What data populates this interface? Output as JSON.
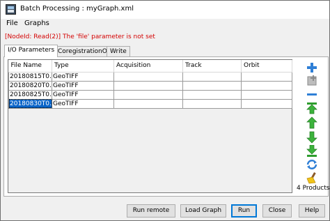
{
  "window": {
    "title": "Batch Processing : myGraph.xml"
  },
  "menu": {
    "items": [
      "File",
      "Graphs"
    ]
  },
  "status": {
    "error": "[NodeId: Read(2)] The 'file' parameter is not set"
  },
  "tabs": [
    {
      "label": "I/O Parameters",
      "active": true
    },
    {
      "label": "CoregistrationOp",
      "active": false
    },
    {
      "label": "Write",
      "active": false
    }
  ],
  "table": {
    "columns": [
      "File Name",
      "Type",
      "Acquisition",
      "Track",
      "Orbit"
    ],
    "rows": [
      {
        "file": "20180815T0...",
        "type": "GeoTIFF",
        "acquisition": "",
        "track": "",
        "orbit": "",
        "selected": false
      },
      {
        "file": "20180820T0...",
        "type": "GeoTIFF",
        "acquisition": "",
        "track": "",
        "orbit": "",
        "selected": false
      },
      {
        "file": "20180825T0...",
        "type": "GeoTIFF",
        "acquisition": "",
        "track": "",
        "orbit": "",
        "selected": false
      },
      {
        "file": "20180830T0...",
        "type": "GeoTIFF",
        "acquisition": "",
        "track": "",
        "orbit": "",
        "selected": true
      }
    ]
  },
  "toolbar": {
    "icons": [
      "add-icon",
      "add-opened-icon",
      "remove-icon",
      "move-top-icon",
      "move-up-icon",
      "move-down-icon",
      "refresh-icon",
      "clear-icon"
    ],
    "products_count": "4 Products"
  },
  "buttons": {
    "run_remote": "Run remote",
    "load_graph": "Load Graph",
    "run": "Run",
    "close": "Close",
    "help": "Help"
  },
  "colors": {
    "error": "#d40000",
    "selection": "#0a64c8",
    "accent": "#0078d7"
  }
}
